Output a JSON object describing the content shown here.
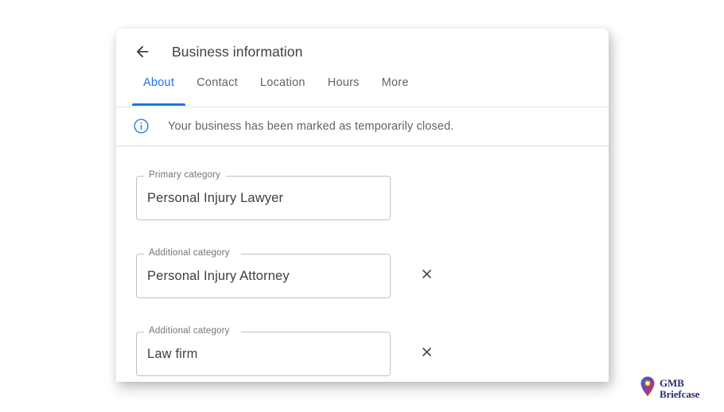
{
  "header": {
    "back_icon": "arrow-left-icon",
    "title": "Business information"
  },
  "tabs": [
    {
      "label": "About",
      "active": true
    },
    {
      "label": "Contact",
      "active": false
    },
    {
      "label": "Location",
      "active": false
    },
    {
      "label": "Hours",
      "active": false
    },
    {
      "label": "More",
      "active": false
    }
  ],
  "banner": {
    "icon": "info-circle-icon",
    "message": "Your business has been marked as temporarily closed."
  },
  "fields": [
    {
      "label": "Primary category",
      "value": "Personal Injury Lawyer",
      "removable": false,
      "remove_icon": "close-icon"
    },
    {
      "label": "Additional category",
      "value": "Personal Injury Attorney",
      "removable": true,
      "remove_icon": "close-icon"
    },
    {
      "label": "Additional category",
      "value": "Law firm",
      "removable": true,
      "remove_icon": "close-icon"
    }
  ],
  "watermark": {
    "icon": "map-pin-icon",
    "line1": "GMB",
    "line2": "Briefcase"
  },
  "colors": {
    "accent_blue": "#1a73e8",
    "text_primary": "#3c4043",
    "text_secondary": "#5f6368",
    "field_border": "#bdc1c6",
    "divider": "#dadce0",
    "watermark_text": "#2b2f6e"
  }
}
